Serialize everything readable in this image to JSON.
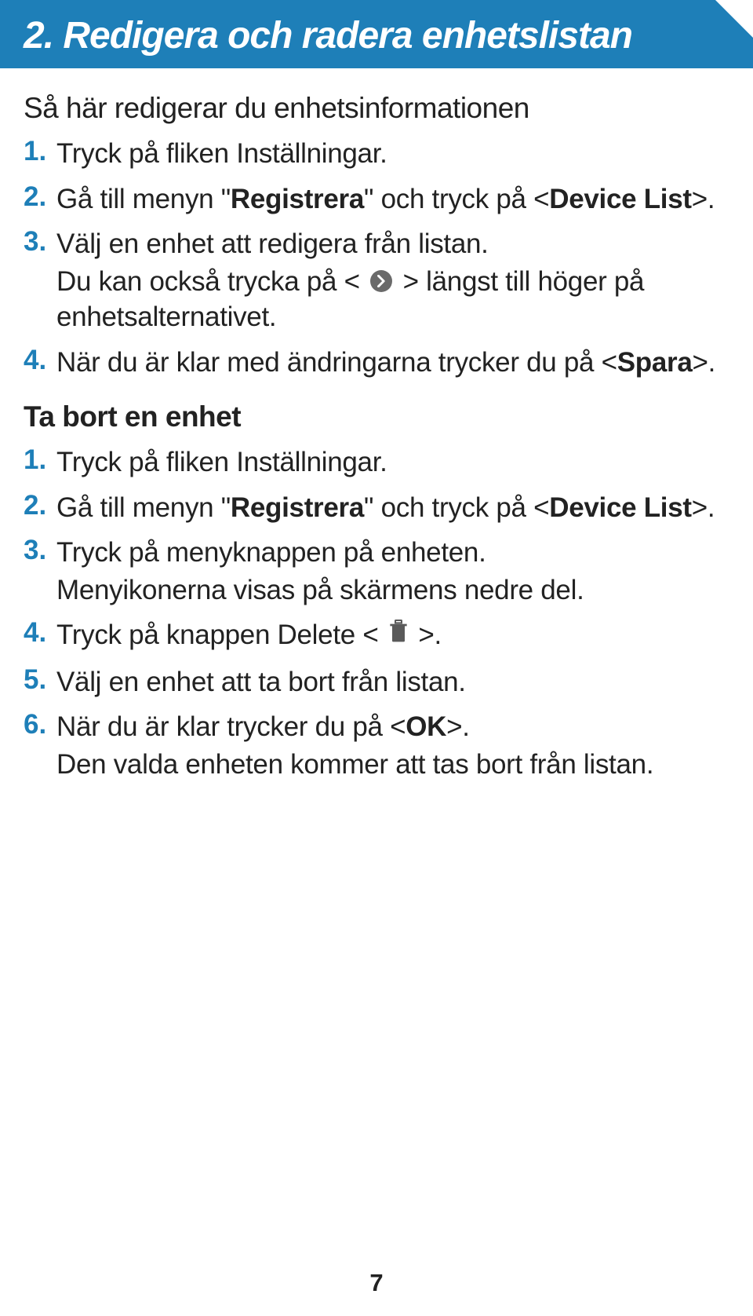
{
  "header": {
    "title": "2. Redigera och radera enhetslistan"
  },
  "section1": {
    "subtitle": "Så här redigerar du enhetsinformationen",
    "steps": [
      {
        "num": "1.",
        "text": "Tryck på fliken Inställningar."
      },
      {
        "num": "2.",
        "text_pre": "Gå till menyn \"",
        "bold1": "Registrera",
        "text_mid": "\" och tryck på <",
        "bold2": "Device List",
        "text_end": ">."
      },
      {
        "num": "3.",
        "text": "Välj en enhet att redigera från listan.",
        "sub_pre": "Du kan också trycka på < ",
        "sub_post": " > längst till höger på enhetsalternativet."
      },
      {
        "num": "4.",
        "text_pre": "När du är klar med ändringarna trycker du på <",
        "bold1": "Spara",
        "text_end": ">."
      }
    ]
  },
  "section2": {
    "title": "Ta bort en enhet",
    "steps": [
      {
        "num": "1.",
        "text": "Tryck på fliken Inställningar."
      },
      {
        "num": "2.",
        "text_pre": "Gå till menyn \"",
        "bold1": "Registrera",
        "text_mid": "\" och tryck på <",
        "bold2": "Device List",
        "text_end": ">."
      },
      {
        "num": "3.",
        "text": "Tryck på menyknappen på enheten.",
        "sub": "Menyikonerna visas på skärmens nedre del."
      },
      {
        "num": "4.",
        "text_pre": "Tryck på knappen Delete < ",
        "text_end": " >."
      },
      {
        "num": "5.",
        "text": "Välj en enhet att ta bort från listan."
      },
      {
        "num": "6.",
        "text_pre": "När du är klar trycker du på <",
        "bold1": "OK",
        "text_end": ">.",
        "sub": "Den valda enheten kommer att tas bort från listan."
      }
    ]
  },
  "page_number": "7"
}
